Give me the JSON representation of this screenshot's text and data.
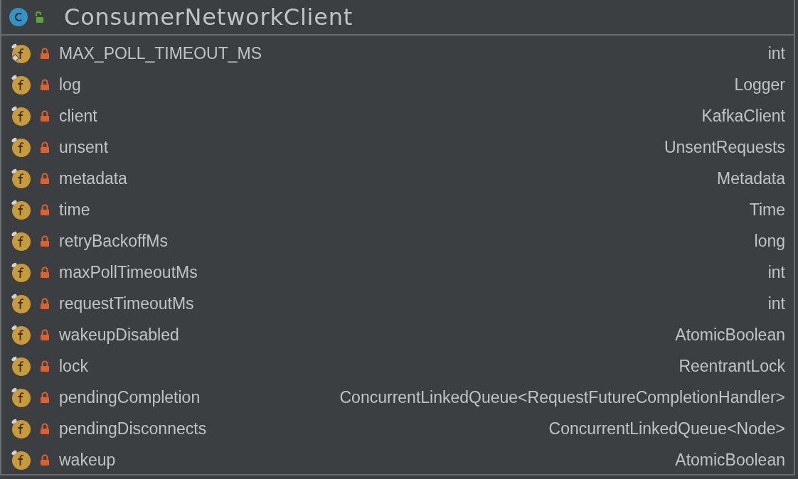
{
  "class": {
    "name": "ConsumerNetworkClient",
    "public": true
  },
  "fields": [
    {
      "name": "MAX_POLL_TIMEOUT_MS",
      "type": "int",
      "static": true
    },
    {
      "name": "log",
      "type": "Logger",
      "static": false
    },
    {
      "name": "client",
      "type": "KafkaClient",
      "static": false
    },
    {
      "name": "unsent",
      "type": "UnsentRequests",
      "static": false
    },
    {
      "name": "metadata",
      "type": "Metadata",
      "static": false
    },
    {
      "name": "time",
      "type": "Time",
      "static": false
    },
    {
      "name": "retryBackoffMs",
      "type": "long",
      "static": false
    },
    {
      "name": "maxPollTimeoutMs",
      "type": "int",
      "static": false
    },
    {
      "name": "requestTimeoutMs",
      "type": "int",
      "static": false
    },
    {
      "name": "wakeupDisabled",
      "type": "AtomicBoolean",
      "static": false
    },
    {
      "name": "lock",
      "type": "ReentrantLock",
      "static": false
    },
    {
      "name": "pendingCompletion",
      "type": "ConcurrentLinkedQueue<RequestFutureCompletionHandler>",
      "static": false
    },
    {
      "name": "pendingDisconnects",
      "type": "ConcurrentLinkedQueue<Node>",
      "static": false
    },
    {
      "name": "wakeup",
      "type": "AtomicBoolean",
      "static": false
    }
  ]
}
